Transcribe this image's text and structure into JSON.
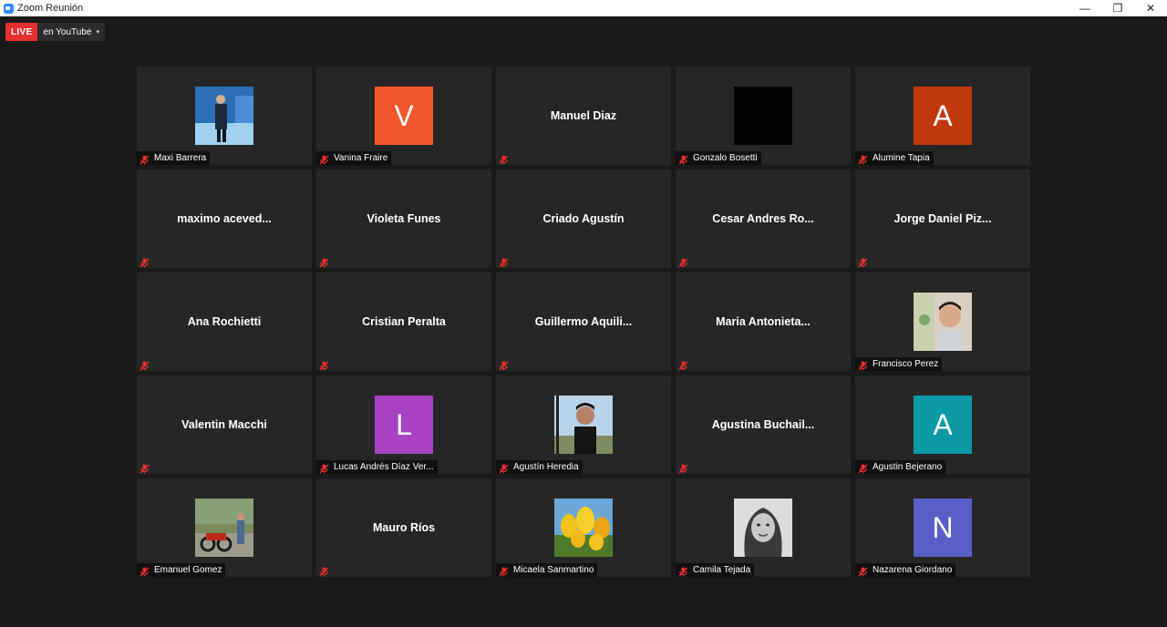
{
  "window": {
    "title": "Zoom Reunión",
    "controls": [
      "—",
      "❐",
      "✕"
    ]
  },
  "live": {
    "badge": "LIVE",
    "destination": "en YouTube",
    "caret": "▾"
  },
  "colors": {
    "background": "#1a1a1a",
    "tile": "#262626",
    "live_red": "#e5302e",
    "muted_red": "#e5302e"
  },
  "participants": [
    {
      "id": "maxi-barrera",
      "center": "photo",
      "photo": "photo-blue-stage",
      "label": "Maxi Barrera"
    },
    {
      "id": "vanina-fraire",
      "center": "avatar",
      "initial": "V",
      "color": "#f1572a",
      "label": "Vanina Fraire"
    },
    {
      "id": "manuel-diaz",
      "center": "name",
      "name": "Manuel Diaz",
      "label": ""
    },
    {
      "id": "gonzalo-bosetti",
      "center": "photo",
      "photo": "photo-black",
      "label": "Gonzalo Bosetti"
    },
    {
      "id": "alumine-tapia",
      "center": "avatar",
      "initial": "A",
      "color": "#c2390f",
      "label": "Alumine Tapia"
    },
    {
      "id": "maximo-aceved",
      "center": "name",
      "name": "maximo  aceved...",
      "label": ""
    },
    {
      "id": "violeta-funes",
      "center": "name",
      "name": "Violeta Funes",
      "label": ""
    },
    {
      "id": "criado-agustin",
      "center": "name",
      "name": "Criado Agustín",
      "label": ""
    },
    {
      "id": "cesar-andres",
      "center": "name",
      "name": "Cesar  Andres  Ro...",
      "label": ""
    },
    {
      "id": "jorge-daniel",
      "center": "name",
      "name": "Jorge  Daniel  Piz...",
      "label": ""
    },
    {
      "id": "ana-rochietti",
      "center": "name",
      "name": "Ana Rochietti",
      "label": ""
    },
    {
      "id": "cristian-peralta",
      "center": "name",
      "name": "Cristian Peralta",
      "label": ""
    },
    {
      "id": "guillermo-aquili",
      "center": "name",
      "name": "Guillermo  Aquili...",
      "label": ""
    },
    {
      "id": "maria-antonieta",
      "center": "name",
      "name": "Maria  Antonieta...",
      "label": ""
    },
    {
      "id": "francisco-perez",
      "center": "photo",
      "photo": "photo-boy",
      "label": "Francisco Perez"
    },
    {
      "id": "valentin-macchi",
      "center": "name",
      "name": "Valentin Macchi",
      "label": ""
    },
    {
      "id": "lucas-andres",
      "center": "avatar",
      "initial": "L",
      "color": "#a844c4",
      "label": "Lucas Andrés Díaz Ver..."
    },
    {
      "id": "agustin-heredia",
      "center": "photo",
      "photo": "photo-outdoor-man",
      "label": "Agustín Heredia"
    },
    {
      "id": "agustina-buchail",
      "center": "name",
      "name": "Agustina  Buchail...",
      "label": ""
    },
    {
      "id": "agustin-bejerano",
      "center": "avatar",
      "initial": "A",
      "color": "#0b9aa6",
      "label": "Agustin Bejerano"
    },
    {
      "id": "emanuel-gomez",
      "center": "photo",
      "photo": "photo-motorbikes",
      "label": "Emanuel Gomez"
    },
    {
      "id": "mauro-rios",
      "center": "name",
      "name": "Mauro Ríos",
      "label": ""
    },
    {
      "id": "micaela-sanmartino",
      "center": "photo",
      "photo": "photo-tulips",
      "label": "Micaela Sanmartino"
    },
    {
      "id": "camila-tejada",
      "center": "photo",
      "photo": "photo-bw-girl",
      "label": "Camila Tejada"
    },
    {
      "id": "nazarena-giordano",
      "center": "avatar",
      "initial": "N",
      "color": "#5a5fc7",
      "label": "Nazarena Giordano"
    }
  ]
}
